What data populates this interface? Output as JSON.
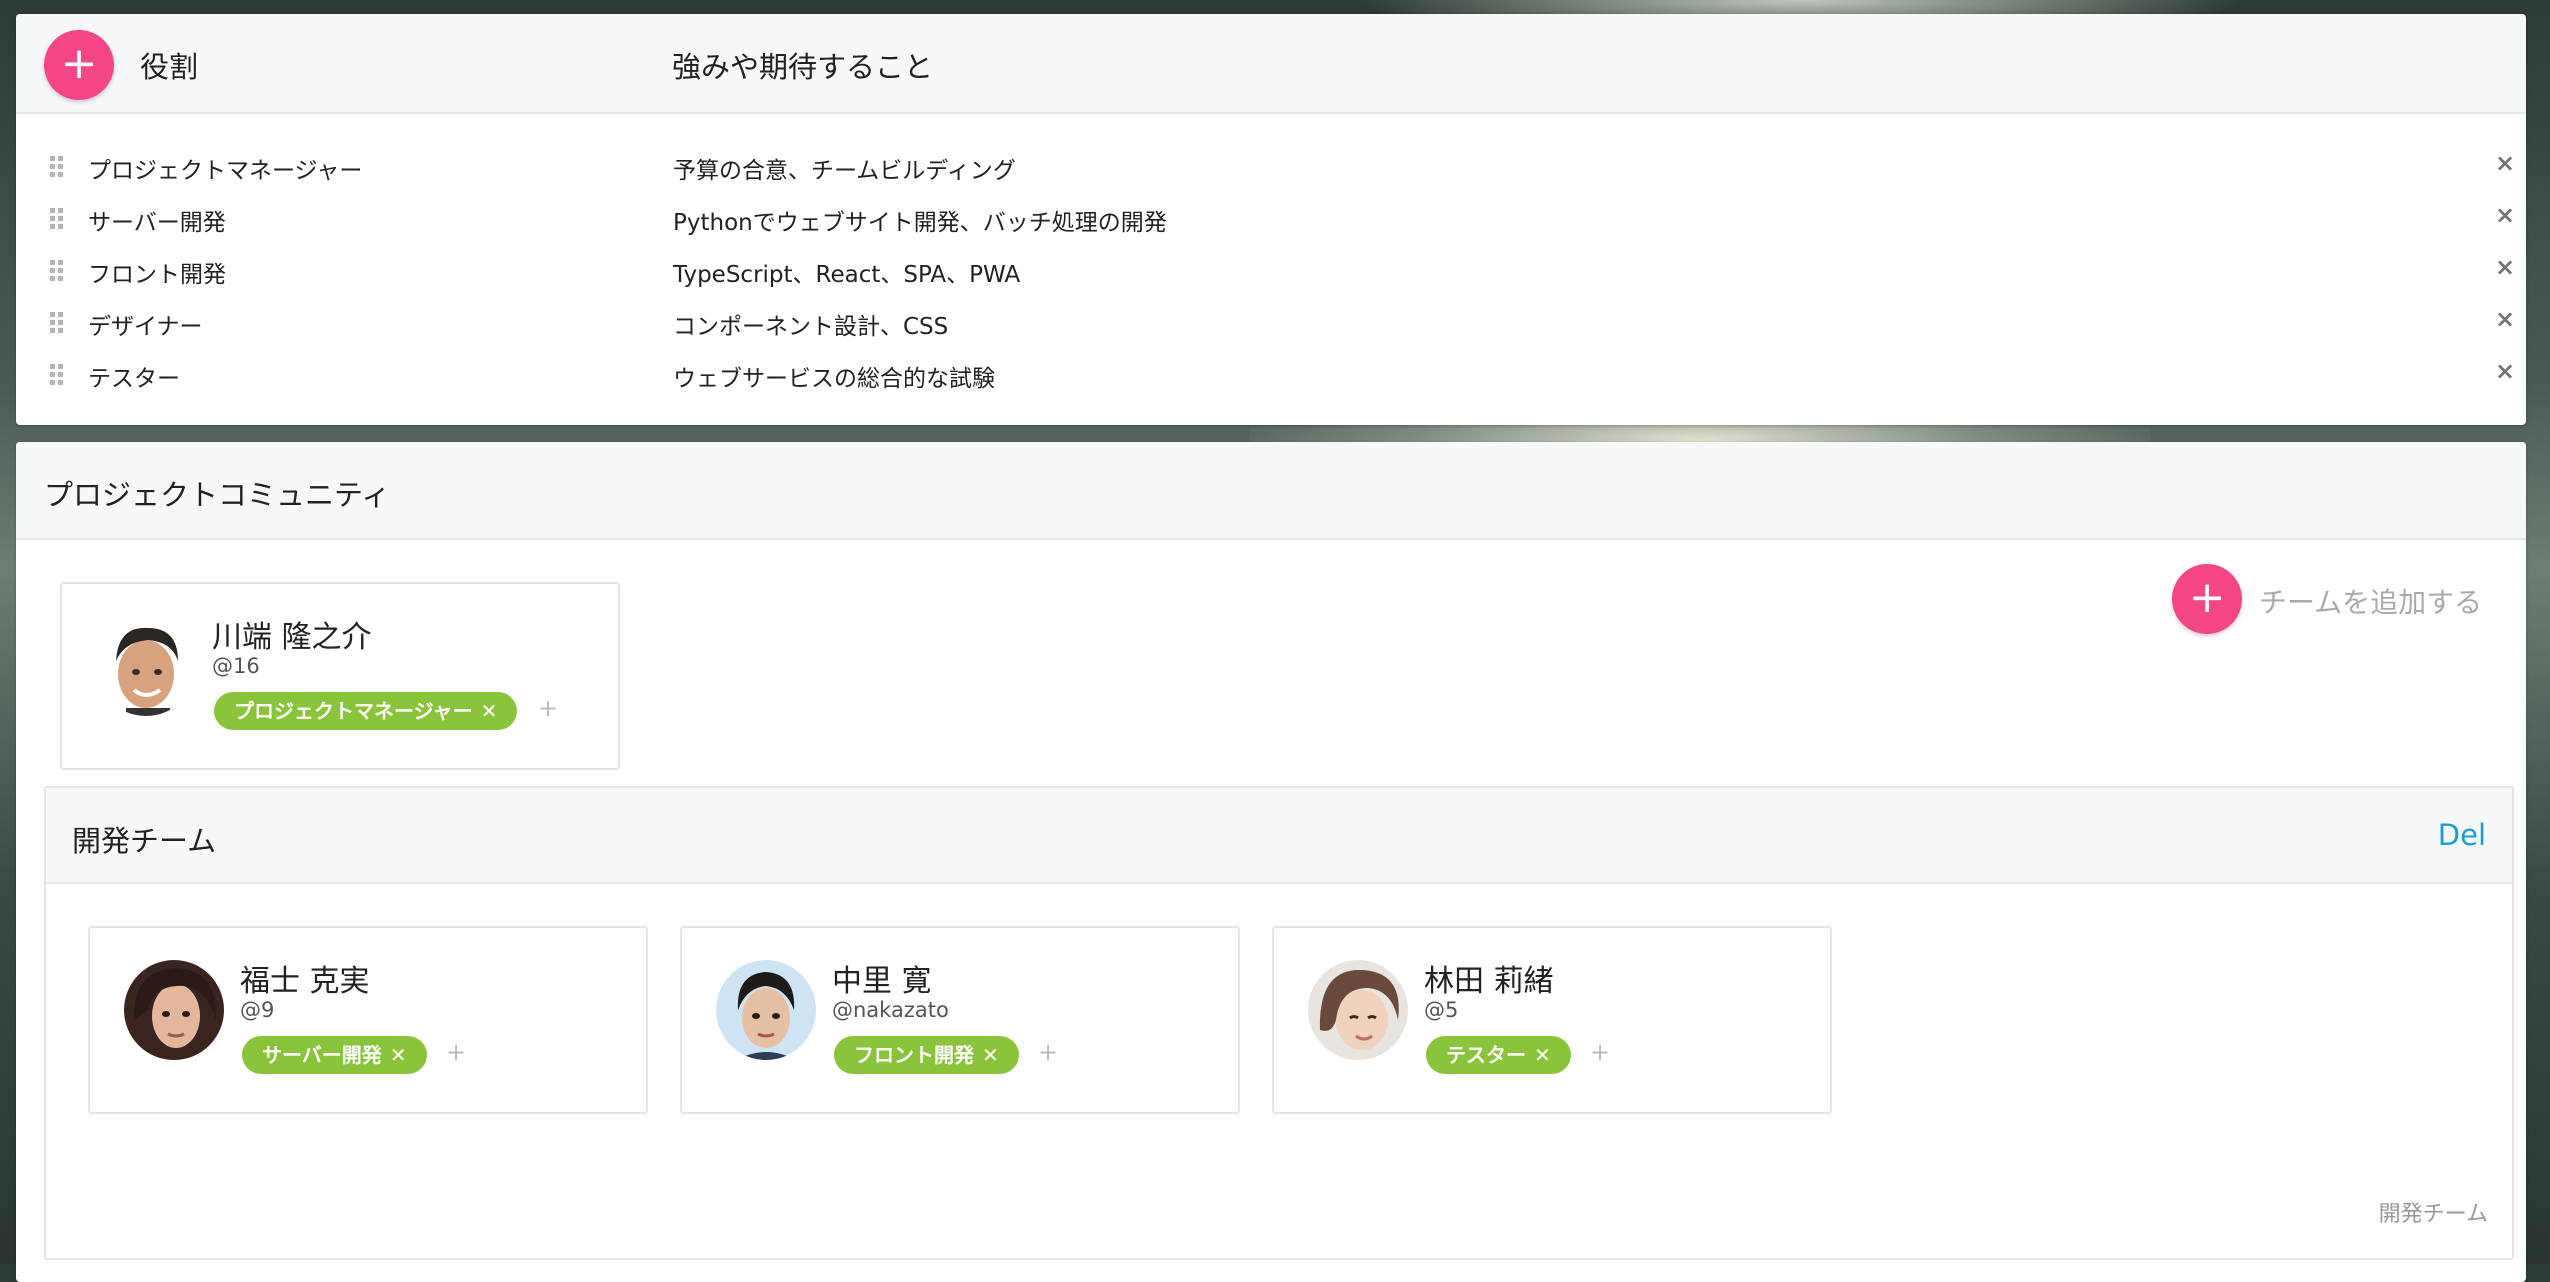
{
  "roles": {
    "add_icon": "plus-icon",
    "col_title": "役割",
    "col_desc": "強みや期待すること",
    "remove_icon": "close-icon",
    "items": [
      {
        "name": "プロジェクトマネージャー",
        "desc": "予算の合意、チームビルディング",
        "remove": "×"
      },
      {
        "name": "サーバー開発",
        "desc": "Pythonでウェブサイト開発、バッチ処理の開発",
        "remove": "×"
      },
      {
        "name": "フロント開発",
        "desc": "TypeScript、React、SPA、PWA",
        "remove": "×"
      },
      {
        "name": "デザイナー",
        "desc": "コンポーネント設計、CSS",
        "remove": "×"
      },
      {
        "name": "テスター",
        "desc": "ウェブサービスの総合的な試験",
        "remove": "×"
      }
    ]
  },
  "community": {
    "title": "プロジェクトコミュニティ",
    "add_team_label": "チームを追加する",
    "fab_symbol": "+",
    "members": [
      {
        "name": "川端 隆之介",
        "handle": "@16",
        "tag": "プロジェクトマネージャー",
        "tag_x": "✕",
        "add": "+"
      }
    ],
    "team": {
      "title": "開発チーム",
      "delete_label": "Del",
      "footer_label": "開発チーム",
      "members": [
        {
          "name": "福士 克実",
          "handle": "@9",
          "tag": "サーバー開発",
          "tag_x": "✕",
          "add": "+"
        },
        {
          "name": "中里 寛",
          "handle": "@nakazato",
          "tag": "フロント開発",
          "tag_x": "✕",
          "add": "+"
        },
        {
          "name": "林田 莉緒",
          "handle": "@5",
          "tag": "テスター",
          "tag_x": "✕",
          "add": "+"
        }
      ]
    }
  },
  "colors": {
    "accent_pink": "#f54788",
    "tag_green": "#8ac43a",
    "link_blue": "#1a9ed6"
  }
}
